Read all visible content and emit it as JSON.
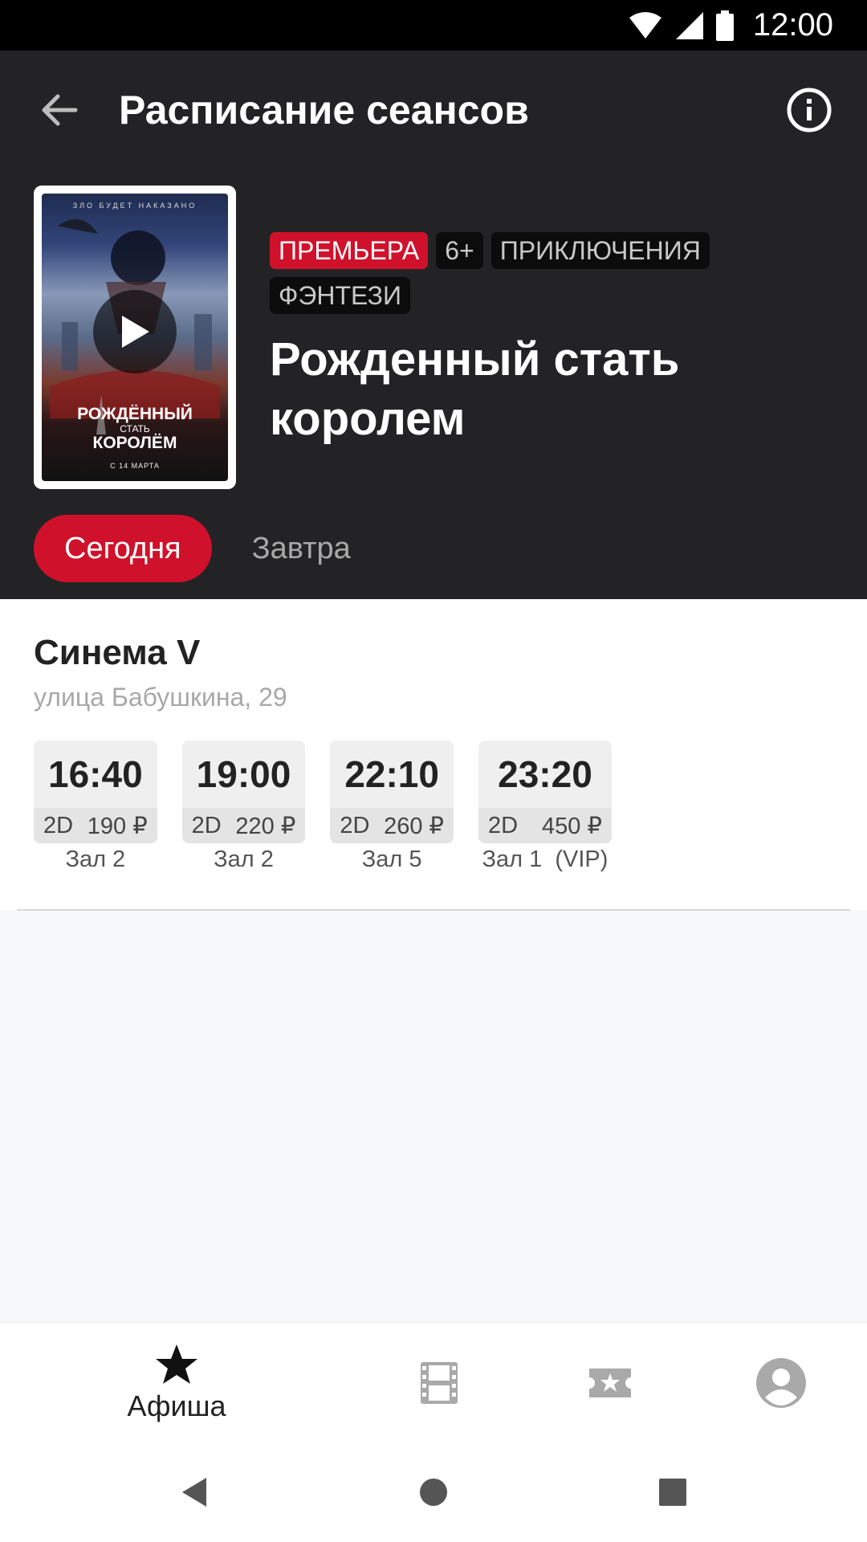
{
  "status_bar": {
    "time": "12:00"
  },
  "header": {
    "title": "Расписание сеансов"
  },
  "movie": {
    "poster": {
      "tagline": "ЗЛО БУДЕТ НАКАЗАНО",
      "title_line1": "РОЖДЁННЫЙ",
      "title_line2": "СТАТЬ",
      "title_line3": "КОРОЛЁМ",
      "release": "С 14 МАРТА"
    },
    "tags": [
      {
        "label": "ПРЕМЬЕРА",
        "color": "#d0112b"
      },
      {
        "label": "6+"
      },
      {
        "label": "ПРИКЛЮЧЕНИЯ"
      },
      {
        "label": "ФЭНТЕЗИ"
      }
    ],
    "title": "Рожденный стать королем"
  },
  "day_tabs": [
    {
      "label": "Сегодня",
      "active": true
    },
    {
      "label": "Завтра",
      "active": false
    }
  ],
  "cinema": {
    "name": "Синема V",
    "address": "улица Бабушкина, 29",
    "sessions": [
      {
        "time": "16:40",
        "format": "2D",
        "price": "190 ₽",
        "hall": "Зал 2"
      },
      {
        "time": "19:00",
        "format": "2D",
        "price": "220 ₽",
        "hall": "Зал 2"
      },
      {
        "time": "22:10",
        "format": "2D",
        "price": "260 ₽",
        "hall": "Зал 5"
      },
      {
        "time": "23:20",
        "format": "2D",
        "price": "450 ₽",
        "hall": "Зал 1  (VIP)"
      }
    ]
  },
  "bottom_nav": [
    {
      "label": "Афиша",
      "icon": "star-icon",
      "active": true
    },
    {
      "label": "",
      "icon": "film-icon"
    },
    {
      "label": "",
      "icon": "ticket-icon"
    },
    {
      "label": "",
      "icon": "profile-icon"
    }
  ],
  "colors": {
    "accent": "#d0112b",
    "header_bg": "#232325"
  }
}
